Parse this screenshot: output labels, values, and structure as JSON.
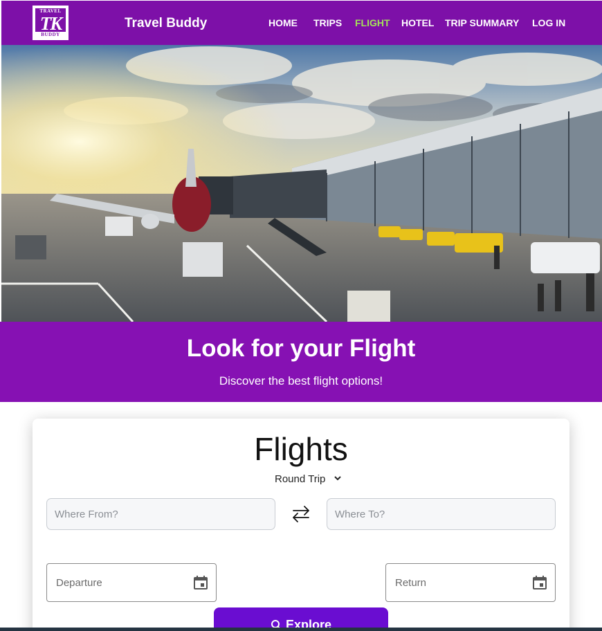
{
  "navbar": {
    "logo": {
      "top_text": "TRAVEL",
      "mark": "TK",
      "bottom_text": "BUDDY"
    },
    "brand": "Travel Buddy",
    "links": [
      {
        "label": "HOME",
        "active": false
      },
      {
        "label": "TRIPS",
        "active": false
      },
      {
        "label": "FLIGHT",
        "active": true
      },
      {
        "label": "HOTEL",
        "active": false
      },
      {
        "label": "TRIP SUMMARY",
        "active": false
      },
      {
        "label": "LOG IN",
        "active": false
      }
    ]
  },
  "hero": {
    "image": "airport-terminal-with-airplane-at-jet-bridge"
  },
  "banner": {
    "title": "Look for your Flight",
    "subtitle": "Discover the best flight options!"
  },
  "search": {
    "title": "Flights",
    "trip_type": "Round Trip",
    "from_placeholder": "Where From?",
    "to_placeholder": "Where To?",
    "departure_label": "Departure",
    "return_label": "Return",
    "explore_label": "Explore",
    "icons": {
      "swap": "swap-arrows-icon",
      "calendar": "calendar-icon",
      "search": "search-icon",
      "dropdown": "chevron-down-icon"
    }
  },
  "colors": {
    "brand_purple": "#7d10a8",
    "banner_purple": "#8611b3",
    "active_link": "#a4e05a",
    "button_purple": "#6a0dd1"
  }
}
